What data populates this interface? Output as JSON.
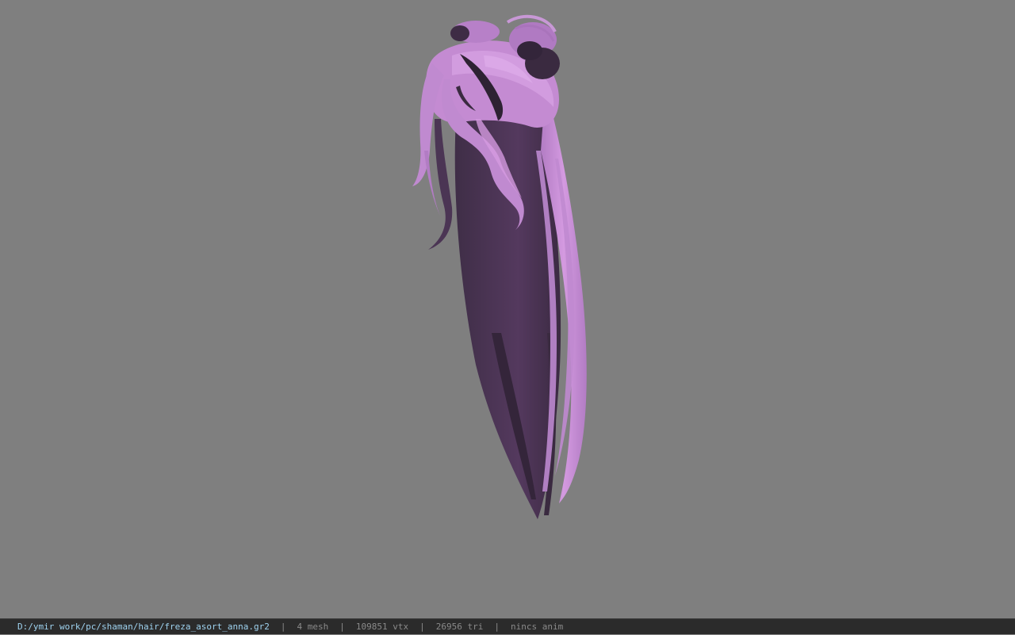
{
  "viewport": {
    "background_color": "#7f7f7f",
    "model": {
      "subject": "hair-model",
      "colors": {
        "light": "#c98fd6",
        "mid": "#a66fb8",
        "shadow": "#4a3552",
        "dark": "#3a2a40"
      }
    }
  },
  "statusbar": {
    "file_path": "D:/ymir work/pc/shaman/hair/freza_asort_anna.gr2",
    "separator": "|",
    "mesh": "4 mesh",
    "vtx": "109851 vtx",
    "tri": "26956 tri",
    "anim": "nincs anim",
    "colors": {
      "background": "#2b2b2b",
      "path": "#9fd3f0",
      "stats": "#8a8a8a"
    }
  }
}
